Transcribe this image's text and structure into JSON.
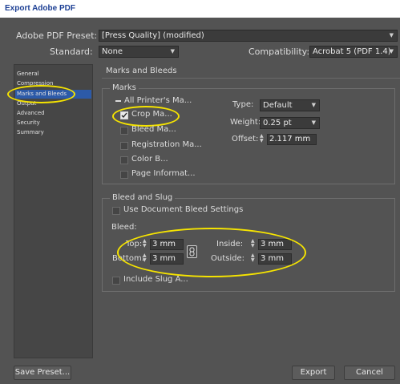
{
  "window": {
    "title": "Export Adobe PDF"
  },
  "top": {
    "preset_label": "Adobe PDF Preset:",
    "preset_value": "[Press Quality] (modified)",
    "standard_label": "Standard:",
    "standard_value": "None",
    "compat_label": "Compatibility:",
    "compat_value": "Acrobat 5 (PDF 1.4)"
  },
  "sidebar": {
    "items": [
      {
        "label": "General",
        "selected": false
      },
      {
        "label": "Compression",
        "selected": false
      },
      {
        "label": "Marks and Bleeds",
        "selected": true
      },
      {
        "label": "Output",
        "selected": false
      },
      {
        "label": "Advanced",
        "selected": false
      },
      {
        "label": "Security",
        "selected": false
      },
      {
        "label": "Summary",
        "selected": false
      }
    ]
  },
  "panel": {
    "title": "Marks and Bleeds"
  },
  "marks": {
    "group_label": "Marks",
    "all_printers": "All Printer's Ma...",
    "crop": "Crop Ma...",
    "bleed": "Bleed Ma...",
    "registration": "Registration Ma...",
    "color_bars": "Color B...",
    "page_info": "Page Informat...",
    "type_label": "Type:",
    "type_value": "Default",
    "weight_label": "Weight:",
    "weight_value": "0.25 pt",
    "offset_label": "Offset:",
    "offset_value": "2.117 mm",
    "checked": {
      "all_printers": false,
      "crop": true,
      "bleed": false,
      "registration": false,
      "color_bars": false,
      "page_info": false
    }
  },
  "bleed": {
    "group_label": "Bleed and Slug",
    "use_document": "Use Document Bleed Settings",
    "bleed_label": "Bleed:",
    "top_label": "Top:",
    "top_value": "3 mm",
    "bottom_label": "Bottom:",
    "bottom_value": "3 mm",
    "inside_label": "Inside:",
    "inside_value": "3 mm",
    "outside_label": "Outside:",
    "outside_value": "3 mm",
    "include_slug": "Include Slug A..."
  },
  "buttons": {
    "save_preset": "Save Preset...",
    "export": "Export",
    "cancel": "Cancel"
  },
  "colors": {
    "highlight": "#f6e400",
    "selection": "#2c5aa8"
  }
}
